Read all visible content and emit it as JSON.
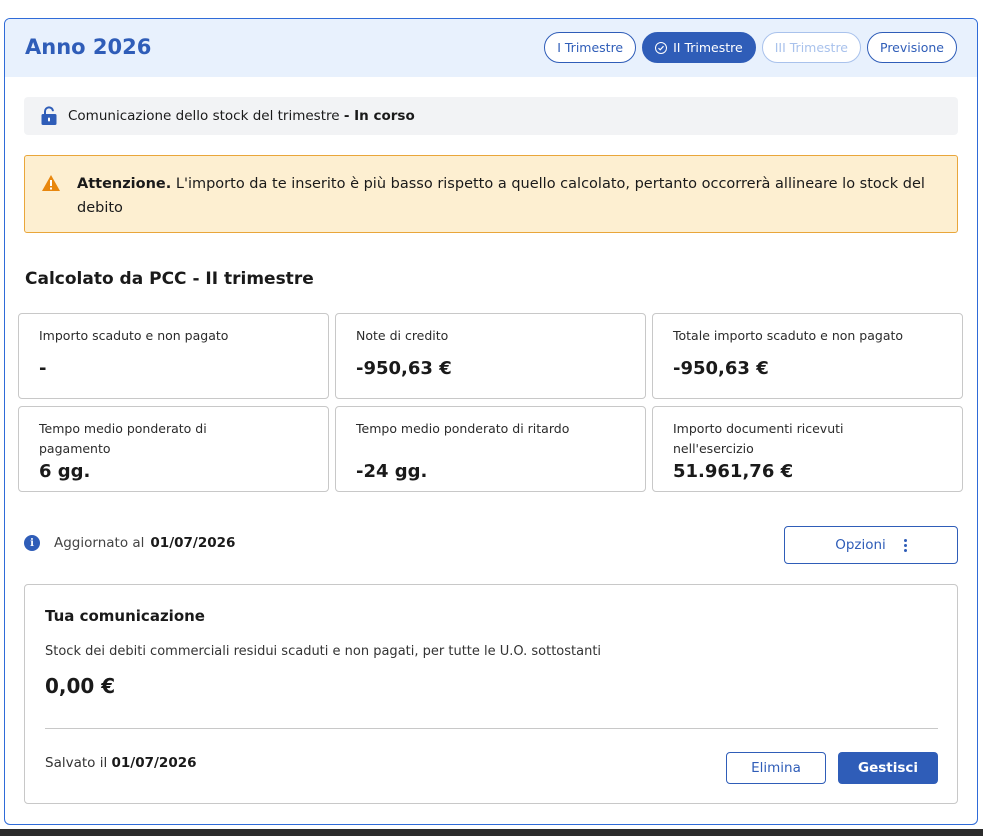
{
  "header": {
    "year_title": "Anno 2026",
    "tabs": [
      {
        "label": "I Trimestre",
        "state": "default"
      },
      {
        "label": "II Trimestre",
        "state": "active"
      },
      {
        "label": "III Trimestre",
        "state": "disabled"
      },
      {
        "label": "Previsione",
        "state": "default"
      }
    ]
  },
  "status": {
    "text": "Comunicazione dello stock del trimestre",
    "state": "- In corso"
  },
  "warning": {
    "title": "Attenzione.",
    "message": " L'importo da te inserito è più basso rispetto a quello calcolato, pertanto occorrerà allineare lo stock del debito"
  },
  "section": {
    "title": "Calcolato da PCC - II trimestre"
  },
  "cards": [
    {
      "label": "Importo scaduto e non pagato",
      "value": "-"
    },
    {
      "label": "Note di credito",
      "value": "-950,63 €"
    },
    {
      "label": "Totale importo scaduto e non pagato",
      "value": "-950,63 €"
    },
    {
      "label": "Tempo medio ponderato di pagamento",
      "value": "6 gg."
    },
    {
      "label": "Tempo medio ponderato di ritardo",
      "value": "-24 gg."
    },
    {
      "label": "Importo documenti ricevuti nell'esercizio",
      "value": "51.961,76 €"
    }
  ],
  "updated": {
    "label": "Aggiornato al",
    "date": "01/07/2026"
  },
  "options": {
    "label": "Opzioni"
  },
  "communication": {
    "title": "Tua comunicazione",
    "description": "Stock dei debiti commerciali residui scaduti e non pagati, per tutte le U.O. sottostanti",
    "value": "0,00 €",
    "saved_label": "Salvato il",
    "saved_date": "01/07/2026",
    "delete_label": "Elimina",
    "manage_label": "Gestisci"
  },
  "colors": {
    "primary": "#2f5db8",
    "header_bg": "#e8f1fd",
    "warning_bg": "#fdefd1",
    "warning_border": "#e9a63a",
    "warning_icon": "#e8870e"
  }
}
